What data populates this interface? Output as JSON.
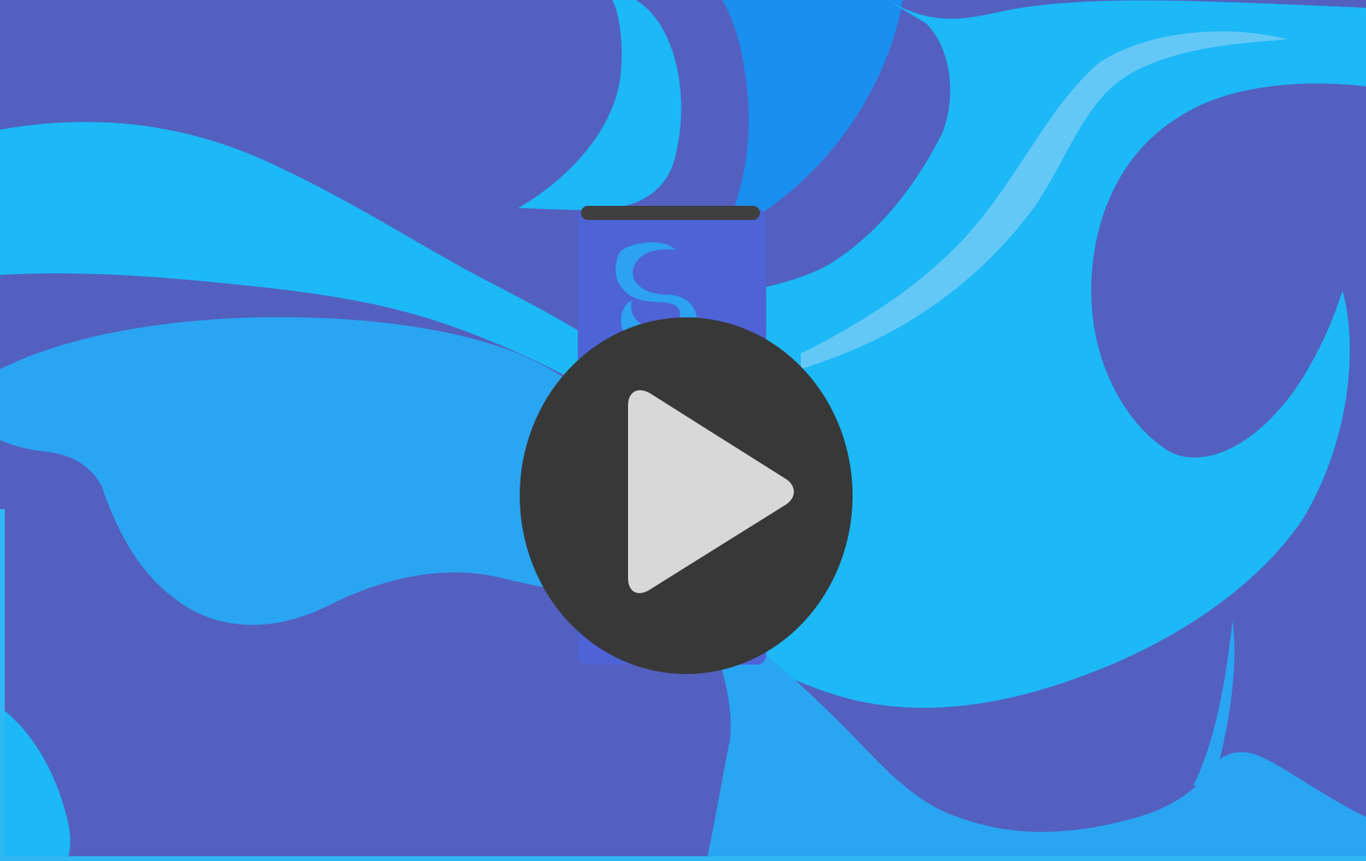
{
  "video": {
    "label": "",
    "colors": {
      "background_dark": "#5360BF",
      "flame_light": "#1DB8F6",
      "flame_mid": "#2AA5F2",
      "flame_highlight": "#64C8F7",
      "can_body": "#4E63D6",
      "can_lid": "#3F3F3F",
      "accent_border": "#2FB8F4"
    },
    "icons": {
      "background": "flame-pattern",
      "product": "energy-drink-can",
      "logo": "swirl-logo"
    }
  },
  "play_button": {
    "icon": "play-icon",
    "colors": {
      "circle": "#383838",
      "triangle": "#D8D8D8"
    }
  }
}
